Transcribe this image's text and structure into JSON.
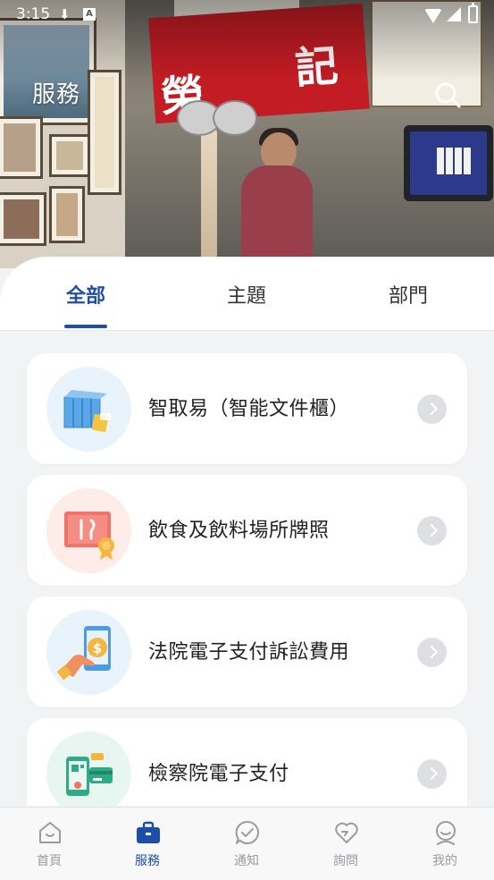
{
  "status_bar": {
    "time": "3:15"
  },
  "header": {
    "title": "服務",
    "banner_chars": [
      "榮",
      "記"
    ]
  },
  "tabs": [
    {
      "label": "全部",
      "active": true
    },
    {
      "label": "主題",
      "active": false
    },
    {
      "label": "部門",
      "active": false
    }
  ],
  "services": [
    {
      "label": "智取易（智能文件櫃）",
      "icon": "smart-locker-icon",
      "icon_bg": "#e9f3fc"
    },
    {
      "label": "飲食及飲料場所牌照",
      "icon": "food-licence-icon",
      "icon_bg": "#fdece8"
    },
    {
      "label": "法院電子支付訴訟費用",
      "icon": "court-payment-icon",
      "icon_bg": "#e9f3fc"
    },
    {
      "label": "檢察院電子支付",
      "icon": "prosecution-payment-icon",
      "icon_bg": "#e8f6f1"
    }
  ],
  "bottom_nav": [
    {
      "label": "首頁",
      "icon": "home-icon",
      "active": false
    },
    {
      "label": "服務",
      "icon": "briefcase-icon",
      "active": true
    },
    {
      "label": "通知",
      "icon": "notification-icon",
      "active": false
    },
    {
      "label": "詢問",
      "icon": "enquiry-icon",
      "active": false
    },
    {
      "label": "我的",
      "icon": "profile-icon",
      "active": false
    }
  ],
  "colors": {
    "accent": "#1d4fa6",
    "inactive": "#9a9ca1",
    "background": "#f2f3f5"
  }
}
